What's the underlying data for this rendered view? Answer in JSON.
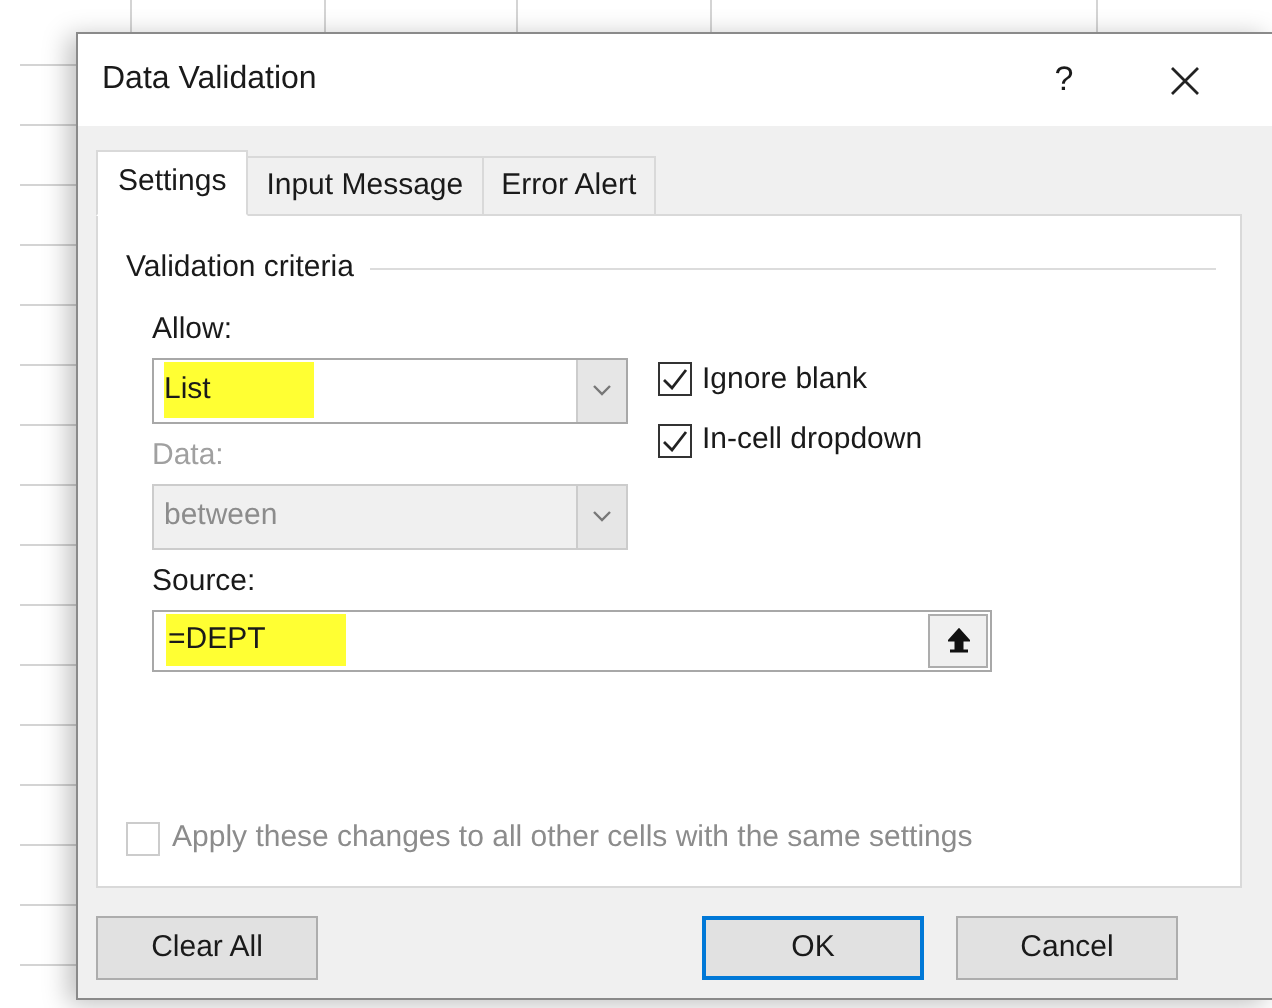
{
  "window": {
    "title": "Data Validation",
    "help": "?"
  },
  "tabs": [
    {
      "label": "Settings",
      "selected": true
    },
    {
      "label": "Input Message",
      "selected": false
    },
    {
      "label": "Error Alert",
      "selected": false
    }
  ],
  "section_title": "Validation criteria",
  "allow": {
    "label": "Allow:",
    "value": "List",
    "highlighted": true,
    "disabled": false
  },
  "data": {
    "label": "Data:",
    "value": "between",
    "disabled": true
  },
  "checkboxes": [
    {
      "label": "Ignore blank",
      "checked": true,
      "disabled": false
    },
    {
      "label": "In-cell dropdown",
      "checked": true,
      "disabled": false
    }
  ],
  "source": {
    "label": "Source:",
    "value": "=DEPT",
    "highlighted": true
  },
  "apply_all": {
    "label": "Apply these changes to all other cells with the same settings",
    "checked": false,
    "disabled": true
  },
  "buttons": [
    {
      "label": "Clear All",
      "default": false
    },
    {
      "label": "OK",
      "default": true
    },
    {
      "label": "Cancel",
      "default": false
    }
  ]
}
